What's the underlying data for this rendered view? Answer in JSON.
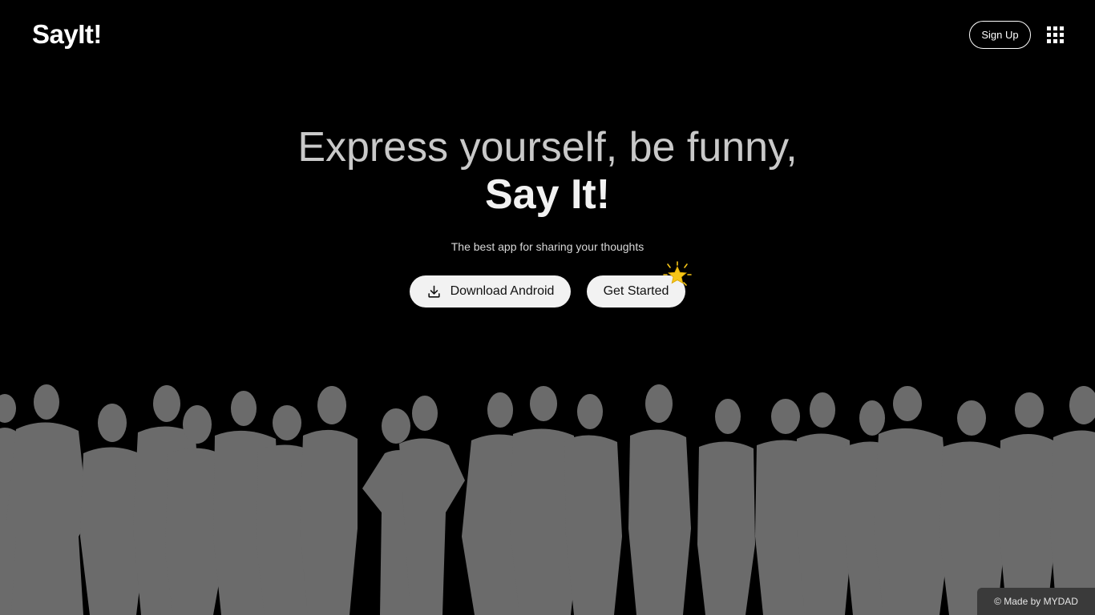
{
  "header": {
    "logo": "SayIt!",
    "signup_label": "Sign Up",
    "menu_icon": "apps-grid-icon"
  },
  "hero": {
    "line1": "Express yourself, be funny,",
    "line2": "Say It!",
    "subtitle": "The best app for sharing your thoughts",
    "download_label": "Download Android",
    "download_icon": "download-icon",
    "get_started_label": "Get Started",
    "badge_icon": "star-icon"
  },
  "footer": {
    "credit": "© Made by MYDAD"
  },
  "colors": {
    "background": "#000000",
    "headline_muted": "#c9c9c9",
    "headline_strong": "#f2f2f2",
    "button_bg": "#f2f2f2",
    "crowd_silhouette": "#6b6b6b",
    "star": "#f5c518",
    "footer_bg": "#3a3a3a"
  }
}
